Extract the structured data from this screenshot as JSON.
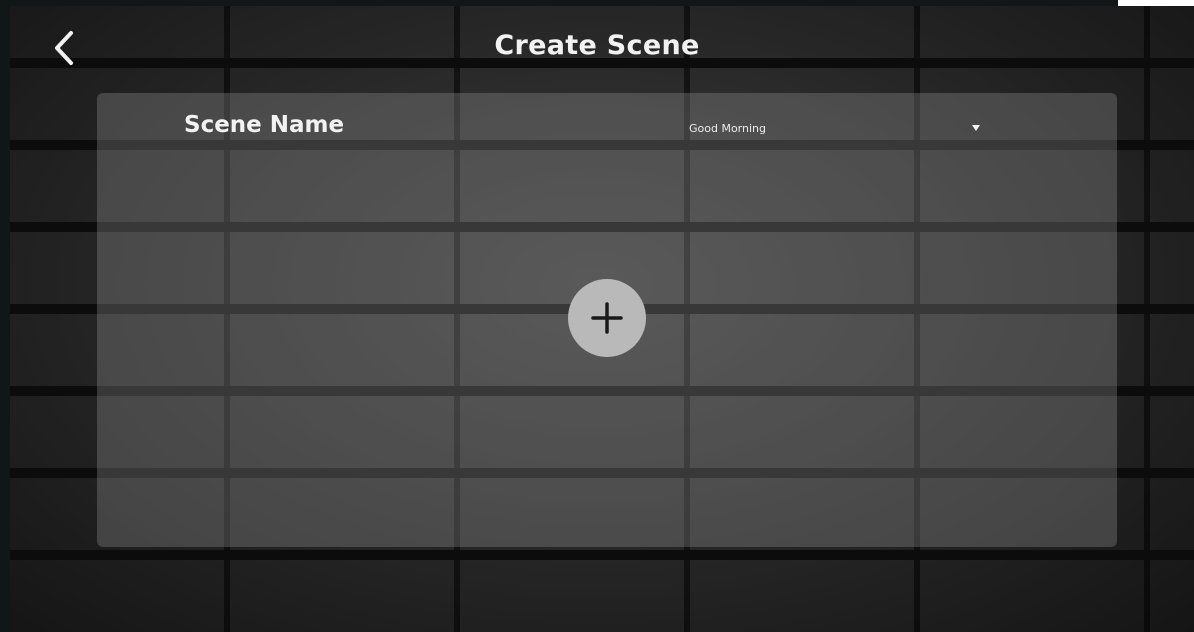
{
  "header": {
    "title": "Create Scene",
    "back_icon": "chevron-left-icon"
  },
  "form": {
    "scene_name_label": "Scene Name",
    "scene_name_value": "Good Morning",
    "dropdown_icon": "caret-down-icon"
  },
  "add_button": {
    "icon": "plus-icon"
  },
  "colors": {
    "text": "#f2f2f2",
    "add_button_bg": "#b9b9b9"
  }
}
